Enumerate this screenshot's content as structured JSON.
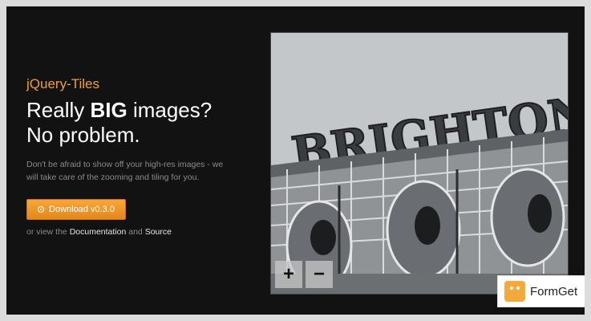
{
  "brand": "jQuery-Tiles",
  "headline": {
    "line1_pre": "Really ",
    "line1_bold": "BIG",
    "line1_post": " images?",
    "line2": "No problem."
  },
  "description": "Don't be afraid to show off your high-res images - we will take care of the zooming and tiling for you.",
  "download_button": {
    "label": "Download v0.3.0",
    "icon": "download-icon"
  },
  "links": {
    "prefix": "or view the ",
    "documentation": "Documentation",
    "and": " and ",
    "source": "Source"
  },
  "viewer": {
    "sign_text": "BRIGHTON P",
    "zoom_in": "+",
    "zoom_out": "−"
  },
  "watermark": "FormGet",
  "colors": {
    "accent": "#f0a030",
    "background": "#121212",
    "outer": "#dcdcdc"
  }
}
